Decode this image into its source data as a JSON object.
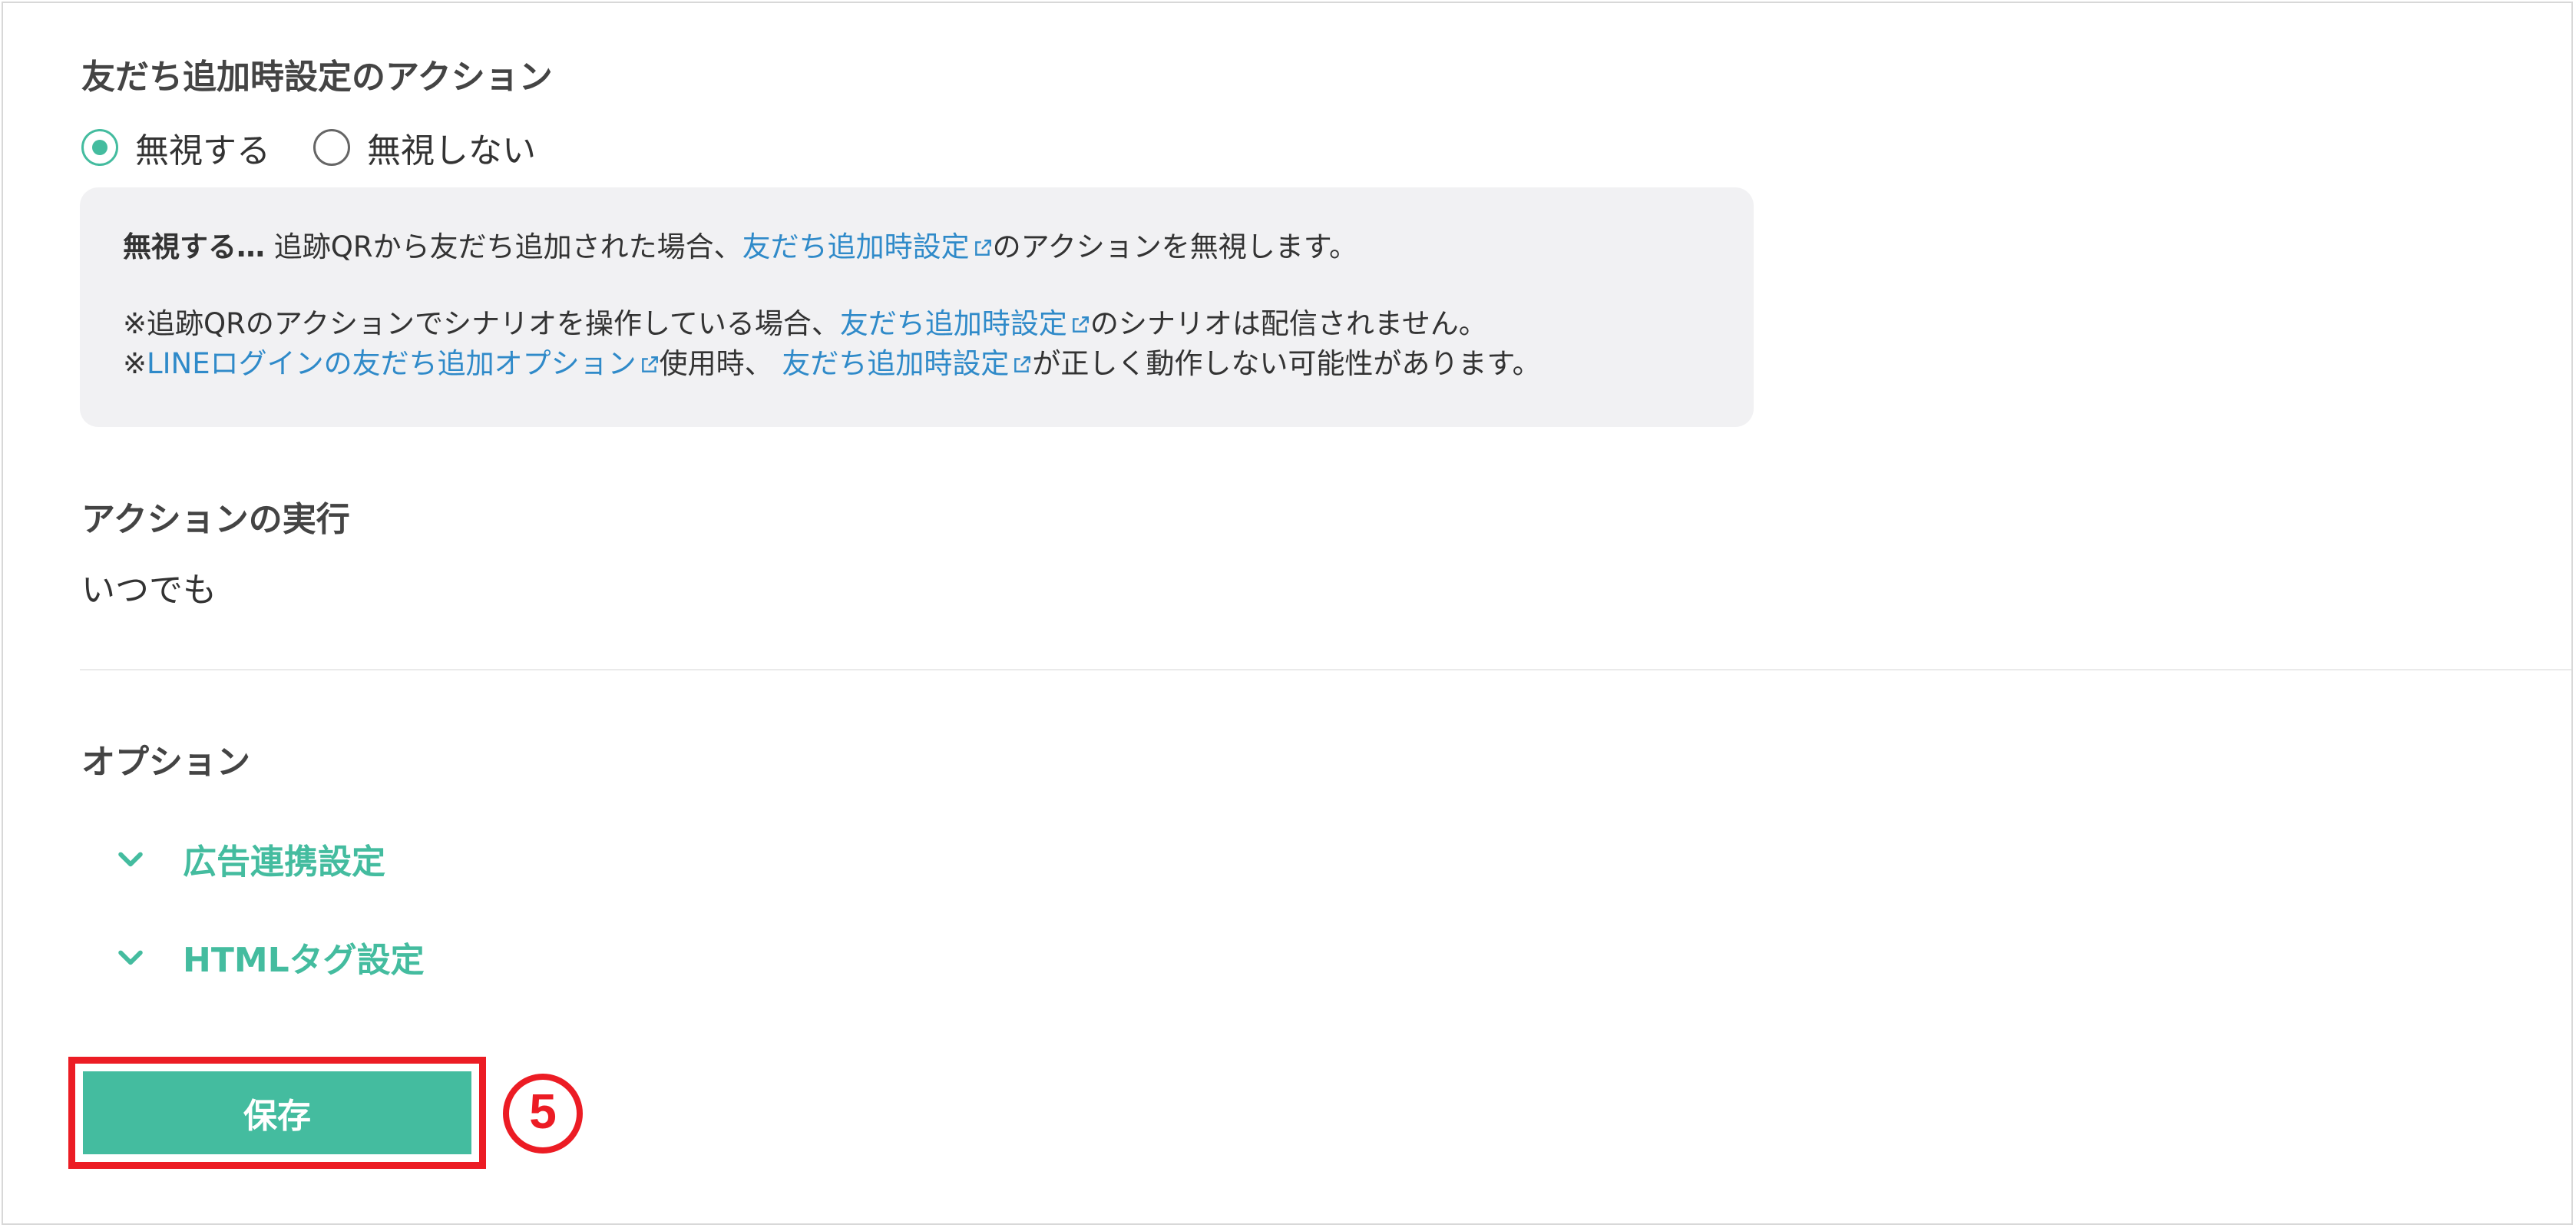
{
  "friend_action": {
    "title": "友だち追加時設定のアクション",
    "options": [
      {
        "label": "無視する",
        "checked": true
      },
      {
        "label": "無視しない",
        "checked": false
      }
    ],
    "info": {
      "line1_bold": "無視する…",
      "line1_text": " 追跡QRから友だち追加された場合、",
      "line1_link": "友だち追加時設定",
      "line1_tail": "のアクションを無視します。",
      "line2_text": "※追跡QRのアクションでシナリオを操作している場合、",
      "line2_link": "友だち追加時設定",
      "line2_tail": "のシナリオは配信されません。",
      "line3_prefix": "※",
      "line3_link1": "LINEログインの友だち追加オプション",
      "line3_mid": "使用時、 ",
      "line3_link2": "友だち追加時設定",
      "line3_tail": "が正しく動作しない可能性があります。"
    }
  },
  "execution": {
    "title": "アクションの実行",
    "value": "いつでも"
  },
  "options_section": {
    "title": "オプション",
    "items": [
      {
        "label": "広告連携設定"
      },
      {
        "label": "HTMLタグ設定"
      }
    ]
  },
  "save": {
    "label": "保存",
    "step_number": "5"
  },
  "colors": {
    "accent": "#44bc9f",
    "link": "#2f8ac9",
    "highlight": "#ec1c24",
    "info_bg": "#f1f1f3"
  },
  "icons": {
    "external": "external-link-icon",
    "chevron": "chevron-down-icon"
  }
}
